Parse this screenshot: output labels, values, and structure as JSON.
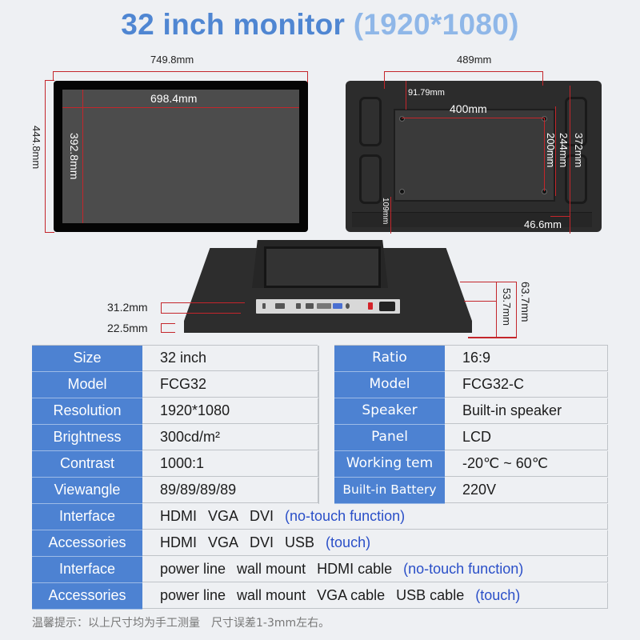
{
  "title": {
    "main": "32 inch monitor",
    "resolution": "(1920*1080)"
  },
  "front_view": {
    "overall_width": "749.8mm",
    "overall_height": "444.8mm",
    "screen_width": "698.4mm",
    "screen_height": "392.8mm"
  },
  "back_view": {
    "overall_width": "489mm",
    "offset_left": "91.79mm",
    "vesa_width": "400mm",
    "vesa_height": "200mm",
    "plate_height": "244mm",
    "overall_height": "372mm",
    "bottom_offset": "109mm",
    "right_offset": "46.6mm"
  },
  "side_view": {
    "depth_io": "31.2mm",
    "depth_frame": "22.5mm",
    "depth_total_outer": "63.7mm",
    "depth_total_inner": "53.7mm"
  },
  "specs_left": [
    {
      "label": "Size",
      "value": "32 inch"
    },
    {
      "label": "Model",
      "value": "FCG32"
    },
    {
      "label": "Resolution",
      "value": "1920*1080"
    },
    {
      "label": "Brightness",
      "value": "300cd/m²"
    },
    {
      "label": "Contrast",
      "value": "1000:1"
    },
    {
      "label": "Viewangle",
      "value": "89/89/89/89"
    }
  ],
  "specs_right": [
    {
      "label": "Ratio",
      "value": "16:9"
    },
    {
      "label": "Model",
      "value": "FCG32-C"
    },
    {
      "label": "Speaker",
      "value": "Built-in speaker"
    },
    {
      "label": "Panel",
      "value": "LCD"
    },
    {
      "label": "Working tem",
      "value": "-20℃ ~ 60℃"
    },
    {
      "label": "Built-in Battery",
      "value": "220V"
    }
  ],
  "specs_full": [
    {
      "label": "Interface",
      "items": [
        "HDMI",
        "VGA",
        "DVI"
      ],
      "note": "(no-touch function)"
    },
    {
      "label": "Accessories",
      "items": [
        "HDMI",
        "VGA",
        "DVI",
        "USB"
      ],
      "note": "(touch)"
    },
    {
      "label": "Interface",
      "items": [
        "power line",
        "wall mount",
        "HDMI cable"
      ],
      "note": "(no-touch function)"
    },
    {
      "label": "Accessories",
      "items": [
        "power line",
        "wall mount",
        "VGA cable",
        "USB cable"
      ],
      "note": "(touch)"
    }
  ],
  "footnote": "温馨提示：以上尺寸均为手工测量　尺寸误差1-3mm左右。",
  "colors": {
    "title_blue": "#4f86d2",
    "title_light_blue": "#8fb7e8",
    "label_bg": "#4d82d2",
    "note_blue": "#2a4fc8",
    "dimension_red": "#c4262b"
  }
}
